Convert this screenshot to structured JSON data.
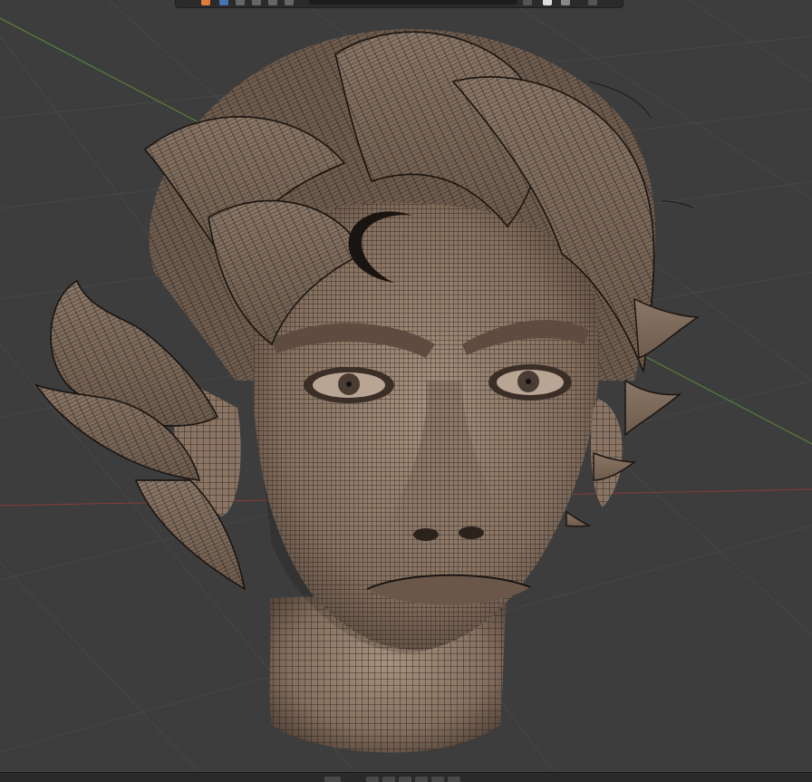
{
  "app": "3D Viewport",
  "viewport": {
    "model": "head-wireframe-sculpt",
    "grid": true,
    "axes": {
      "x_color": "#b34747",
      "y_color": "#5c8a3a"
    },
    "background_color": "#3d3d3d",
    "mesh_color": "#8f7a6a",
    "wire_color": "#1a1512"
  },
  "header": {
    "icons": [
      "editor-type-icon",
      "select-box-icon",
      "cursor-icon",
      "move-icon",
      "rotate-icon",
      "scale-icon",
      "transform-icon",
      "snap-icon",
      "proportional-icon",
      "overlay-icon"
    ]
  },
  "timeline": {
    "buttons": [
      "jump-start-icon",
      "prev-keyframe-icon",
      "play-reverse-icon",
      "play-icon",
      "next-keyframe-icon",
      "jump-end-icon"
    ]
  }
}
